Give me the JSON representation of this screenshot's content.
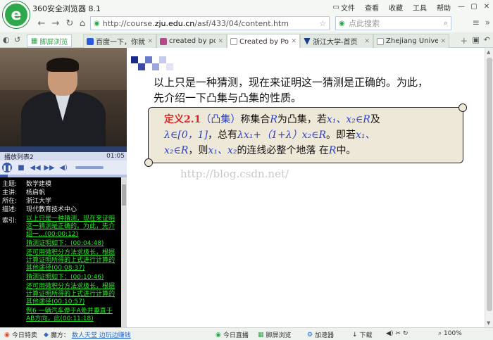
{
  "window": {
    "title": "360安全浏览器 8.1"
  },
  "menu": [
    "文件",
    "查看",
    "收藏",
    "工具",
    "帮助"
  ],
  "nav": {
    "url_prefix": "http://course.",
    "url_domain": "zju.edu.cn",
    "url_suffix": "/asf/433/04/content.htm",
    "search_placeholder": "点此搜索"
  },
  "tabs": {
    "split_label": "脚屏浏览",
    "items": [
      {
        "label": "百度一下，你就知道",
        "active": false,
        "color": "#2a5ad8"
      },
      {
        "label": "created by powe",
        "active": false,
        "color": "#b04a8a"
      },
      {
        "label": "Created by Powe",
        "active": true,
        "color": "#999999"
      },
      {
        "label": "浙江大学-首页",
        "active": false,
        "color": "#1a3a8a"
      },
      {
        "label": "Zhejiang Univers",
        "active": false,
        "color": "#999999"
      }
    ]
  },
  "player": {
    "playlist_label": "播放列表2",
    "time": "01:05",
    "progress_fraction": 0.06
  },
  "info": {
    "rows": [
      {
        "key": "主题:",
        "value": "数学建模"
      },
      {
        "key": "主讲:",
        "value": "杨启帆"
      },
      {
        "key": "所在:",
        "value": "浙江大学"
      },
      {
        "key": "描述:",
        "value": "现代教育技术中心"
      }
    ],
    "index_key": "索引:",
    "index_items": [
      "以上只是一种猜测，现在来证明这一猜测是正确的。为此，先介绍一...(00:00:12)",
      "猜测证明如下：(00:04:48)",
      "还可用微积分方法求极长，根据计算证明所得的上式进行计算的其他途径(00:08:37)",
      "猜测证明如下：(00:10:46)",
      "还可用微积分方法求极长，根据计算证明所得的上式进行计算的其他途径(00:10:57)",
      "例6 一辆汽车停于A处并垂直于AB方向，此(00:11:18)"
    ]
  },
  "slide": {
    "intro_line1": "以上只是一种猜测，现在来证明这一猜测是正确的。为此，",
    "intro_line2": "先介绍一下凸集与凸集的性质。",
    "def_title": "定义2.1",
    "def_paren": "（凸集）",
    "def_l1a": "称集合",
    "def_R": "R",
    "def_l1b": "为凸集，若",
    "def_x1x2": "x₁、x₂∈R",
    "def_l1c": "及",
    "def_l2a": "λ∈[0，1]",
    "def_l2b": "，总有",
    "def_expr": "λx₁+（1+λ）x₂∈R",
    "def_l2c": "。即若",
    "def_x1": "x₁、",
    "def_x2": "x₂∈R",
    "def_l3a": "，则",
    "def_x1x2b": "x₁、x₂",
    "def_l3b": "的连线必整个地落 在",
    "def_R2": "R",
    "def_l3c": "中。",
    "watermark": "http://blog.csdn.net/"
  },
  "status": {
    "today_label": "今日特卖",
    "magic_label": "魔方：",
    "magic_link": "数人天堂 边玩边赚钱",
    "live_label": "今日直播",
    "split_label": "脚屏浏览",
    "accel_label": "加速器",
    "download_label": "下载",
    "zoom": "100%"
  }
}
